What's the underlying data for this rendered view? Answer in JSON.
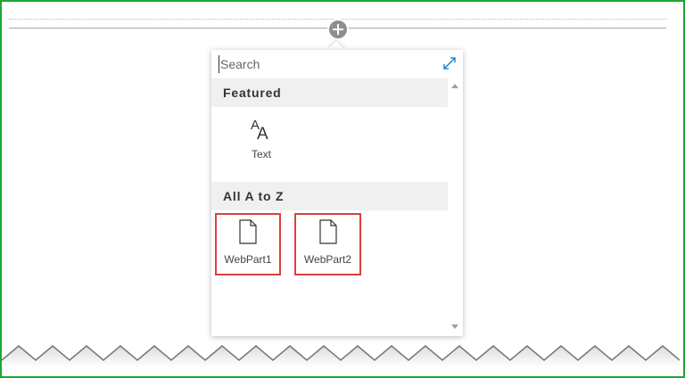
{
  "search": {
    "placeholder": "Search"
  },
  "sections": {
    "featured": {
      "header": "Featured",
      "items": [
        {
          "label": "Text",
          "icon": "text-aa-icon"
        }
      ]
    },
    "all_a_to_z": {
      "header": "All A to Z",
      "items": [
        {
          "label": "WebPart1",
          "icon": "document-icon"
        },
        {
          "label": "WebPart2",
          "icon": "document-icon"
        }
      ]
    }
  },
  "colors": {
    "frame_border": "#21a636",
    "highlight_border": "#d9413f",
    "expand_icon": "#0078d4",
    "add_button": "#8f8f8f"
  }
}
